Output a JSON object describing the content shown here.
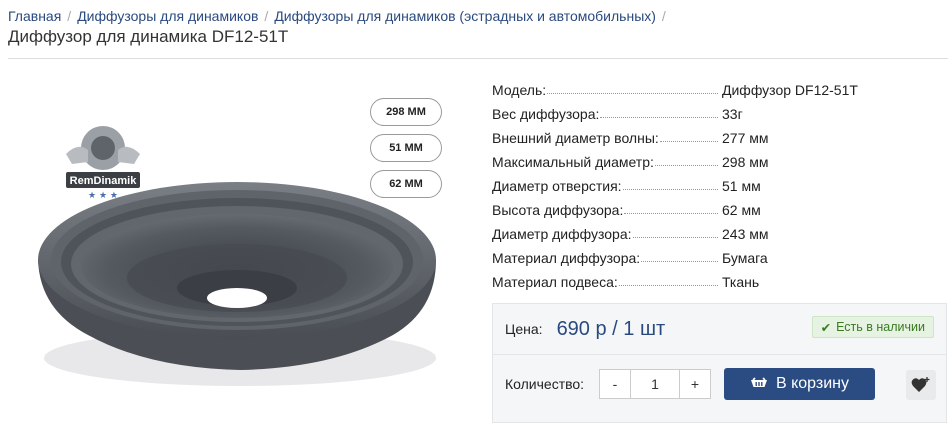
{
  "breadcrumb": {
    "items": [
      "Главная",
      "Диффузоры для динамиков",
      "Диффузоры для динамиков (эстрадных и автомобильных)"
    ],
    "separator": "/"
  },
  "page_title": "Диффузор для динамика DF12-51T",
  "image": {
    "badges": [
      "298 ММ",
      "51 ММ",
      "62 ММ"
    ],
    "logo_text": "RemDinamik"
  },
  "specs": [
    {
      "name": "Модель:",
      "value": "Диффузор DF12-51T"
    },
    {
      "name": "Вес диффузора:",
      "value": "33г"
    },
    {
      "name": "Внешний диаметр волны:",
      "value": "277 мм"
    },
    {
      "name": "Максимальный диаметр:",
      "value": "298 мм"
    },
    {
      "name": "Диаметр отверстия:",
      "value": "51 мм"
    },
    {
      "name": "Высота диффузора:",
      "value": "62 мм"
    },
    {
      "name": "Диаметр диффузора:",
      "value": "243 мм"
    },
    {
      "name": "Материал диффузора:",
      "value": "Бумага"
    },
    {
      "name": "Материал подвеса:",
      "value": "Ткань"
    }
  ],
  "buy": {
    "price_label": "Цена:",
    "price_value": "690 р / 1 шт",
    "stock": "Есть в наличии",
    "qty_label": "Количество:",
    "qty_minus": "-",
    "qty_value": "1",
    "qty_plus": "+",
    "cart_label": "В корзину"
  },
  "colors": {
    "link": "#2a4a7f",
    "cart_button": "#2b4c82",
    "stock_bg": "#e6f2e2",
    "stock_text": "#3a7a22"
  },
  "icons": [
    "check-icon",
    "cart-icon",
    "heart-plus-icon"
  ]
}
